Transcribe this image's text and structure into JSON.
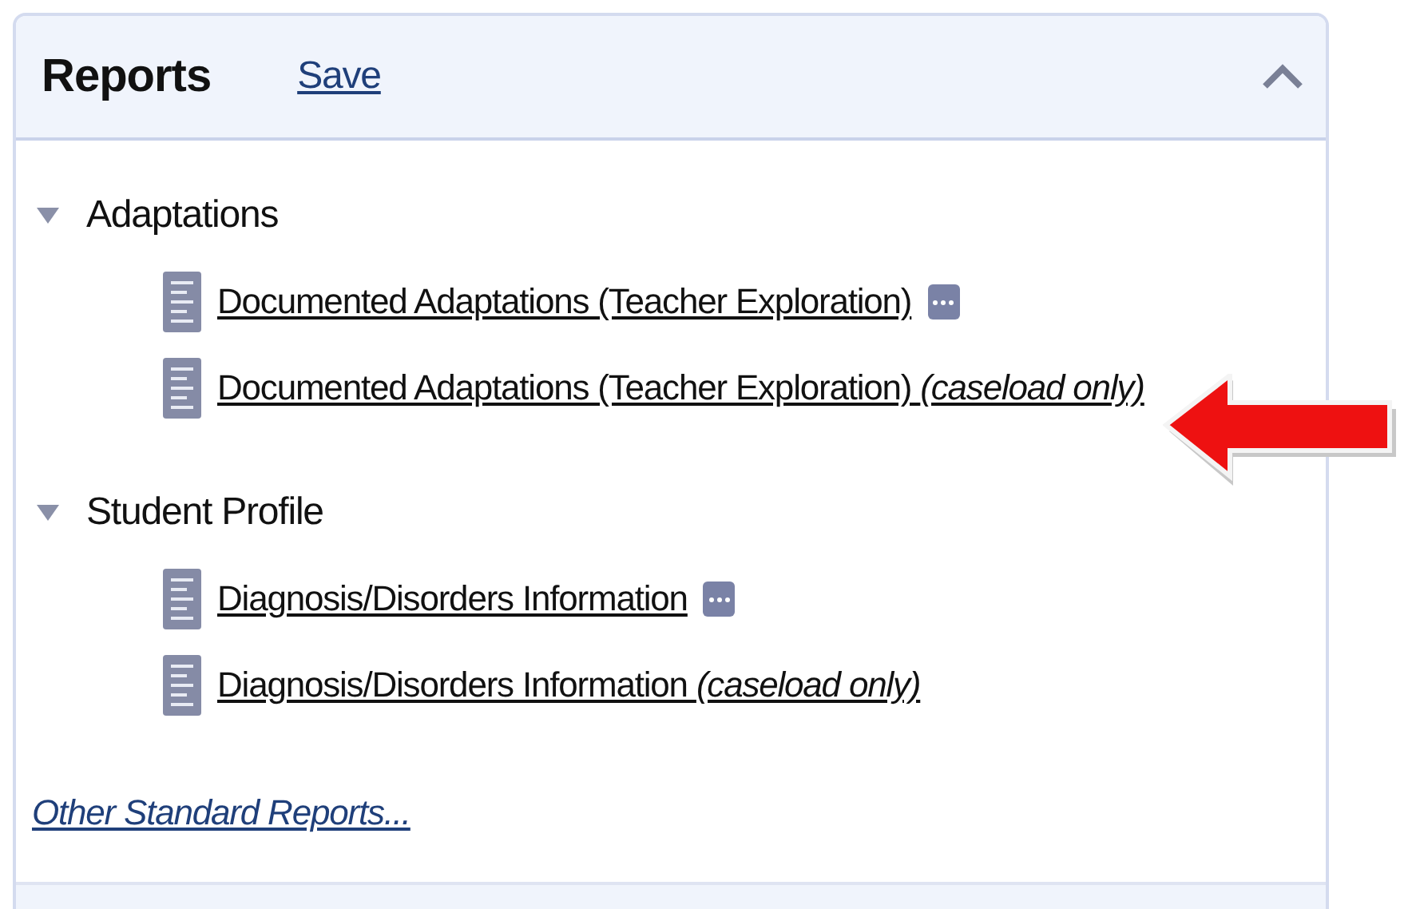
{
  "panel": {
    "title": "Reports",
    "save_link": "Save",
    "expanded": true
  },
  "groups": [
    {
      "label": "Adaptations",
      "expanded": true,
      "children": [
        {
          "label": "Documented Adaptations (Teacher Exploration)",
          "more_button": true,
          "arrow": false
        },
        {
          "label": "Documented Adaptations (Teacher Exploration) *(caseload only)*",
          "more_button": false,
          "arrow": true
        }
      ]
    },
    {
      "label": "Student Profile",
      "expanded": true,
      "children": [
        {
          "label": "Diagnosis/Disorders Information",
          "more_button": true,
          "arrow": false
        },
        {
          "label": "Diagnosis/Disorders Information *(caseload only)*",
          "more_button": false,
          "arrow": false
        }
      ]
    }
  ],
  "footer_link": "Other Standard Reports..."
}
